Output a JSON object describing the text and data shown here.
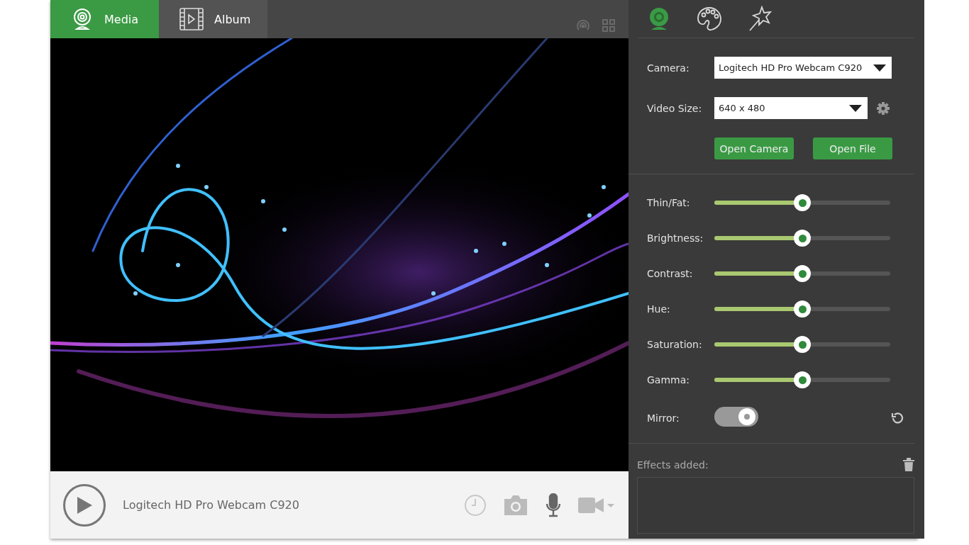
{
  "main_tabs": [
    {
      "label": "Media",
      "kind": "webcam",
      "selected": true
    },
    {
      "label": "Album",
      "kind": "film",
      "selected": false
    }
  ],
  "panel_tabs": [
    {
      "kind": "webcam",
      "selected": true
    },
    {
      "kind": "palette",
      "selected": false
    },
    {
      "kind": "wand",
      "selected": false
    }
  ],
  "camera": {
    "label": "Camera:",
    "value": "Logitech HD Pro Webcam C920"
  },
  "video_size": {
    "label": "Video Size:",
    "value": "640 x 480"
  },
  "buttons": [
    "Open Camera",
    "Open File"
  ],
  "sliders": [
    {
      "label": "Thin/Fat:",
      "level": 0.5
    },
    {
      "label": "Brightness:",
      "level": 0.5
    },
    {
      "label": "Contrast:",
      "level": 0.5
    },
    {
      "label": "Hue:",
      "level": 0.5
    },
    {
      "label": "Saturation:",
      "level": 0.5
    },
    {
      "label": "Gamma:",
      "level": 0.5
    }
  ],
  "mirror": {
    "label": "Mirror:",
    "on": true
  },
  "effects": {
    "label": "Effects added:"
  },
  "player": {
    "device": "Logitech HD Pro Webcam C920"
  }
}
